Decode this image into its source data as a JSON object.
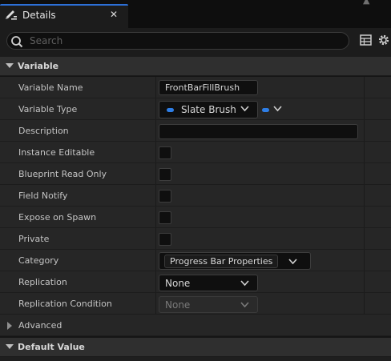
{
  "tab": {
    "title": "Details",
    "close": "✕",
    "corner": "▲"
  },
  "search": {
    "placeholder": "Search"
  },
  "sections": {
    "variable": "Variable",
    "default_value": "Default Value"
  },
  "rows": {
    "variable_name": {
      "label": "Variable Name",
      "value": "FrontBarFillBrush"
    },
    "variable_type": {
      "label": "Variable Type",
      "value": "Slate Brush",
      "pill_color": "#2e7ee6"
    },
    "description": {
      "label": "Description",
      "value": ""
    },
    "instance_editable": {
      "label": "Instance Editable",
      "checked": false
    },
    "blueprint_read_only": {
      "label": "Blueprint Read Only",
      "checked": false
    },
    "field_notify": {
      "label": "Field Notify",
      "checked": false
    },
    "expose_on_spawn": {
      "label": "Expose on Spawn",
      "checked": false
    },
    "private": {
      "label": "Private",
      "checked": false
    },
    "category": {
      "label": "Category",
      "value": "Progress Bar Properties"
    },
    "replication": {
      "label": "Replication",
      "value": "None"
    },
    "replication_condition": {
      "label": "Replication Condition",
      "value": "None",
      "disabled": true
    }
  },
  "advanced": {
    "label": "Advanced"
  },
  "icons": [
    "details-pencil-icon",
    "search-icon",
    "grid-view-icon",
    "gear-icon",
    "chevron-down-icon"
  ],
  "colors": {
    "accent": "#2c6fd6",
    "panel": "#262626",
    "field": "#0f0f0f"
  }
}
